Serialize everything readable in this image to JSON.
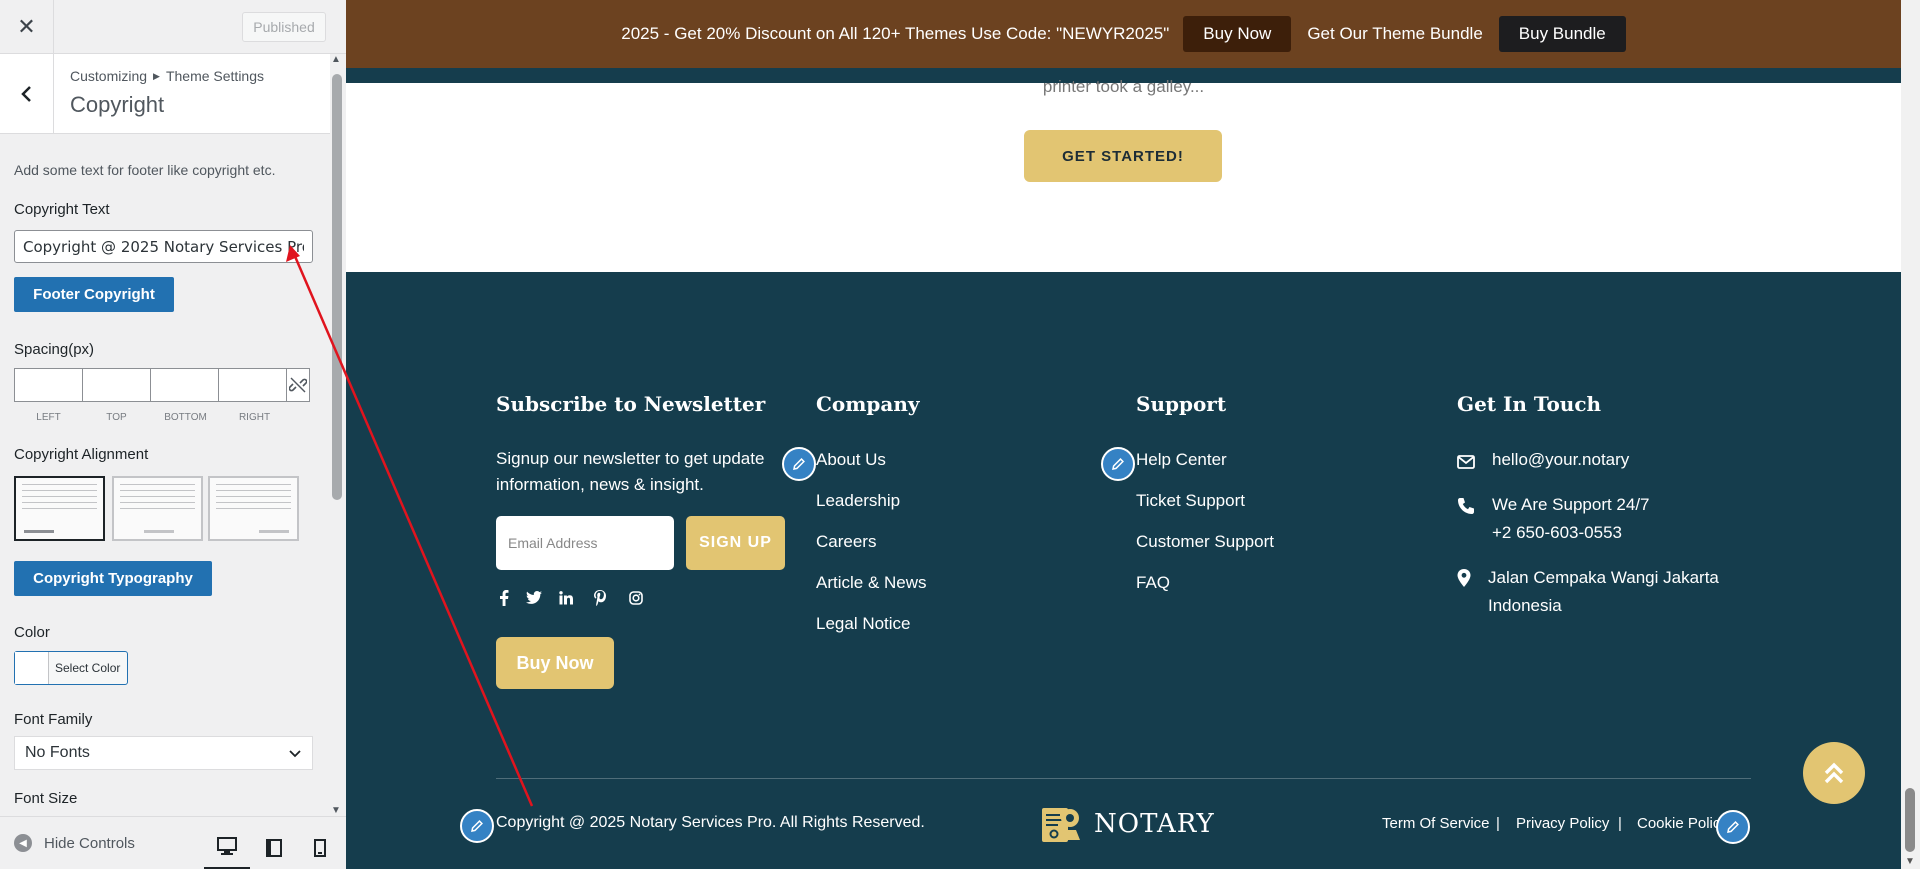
{
  "panel": {
    "close_label": "✕",
    "published_label": "Published",
    "breadcrumb_root": "Customizing",
    "breadcrumb_parent": "Theme Settings",
    "section_title": "Copyright",
    "description": "Add some text for footer like copyright etc.",
    "copyright_text_label": "Copyright Text",
    "copyright_text_value": "Copyright @ 2025 Notary Services Pro. All Rights Reserved.",
    "footer_copyright_button": "Footer Copyright",
    "spacing_label": "Spacing(px)",
    "spacing_captions": [
      "LEFT",
      "TOP",
      "BOTTOM",
      "RIGHT"
    ],
    "alignment_label": "Copyright Alignment",
    "typography_button": "Copyright Typography",
    "color_label": "Color",
    "select_color": "Select Color",
    "font_family_label": "Font Family",
    "font_family_value": "No Fonts",
    "font_size_label": "Font Size",
    "hide_controls": "Hide Controls"
  },
  "preview": {
    "promo": {
      "text": "2025 - Get 20% Discount on All 120+ Themes Use Code: \"NEWYR2025\"",
      "buy_now": "Buy Now",
      "bundle_text": "Get Our Theme Bundle",
      "buy_bundle": "Buy Bundle"
    },
    "hero_text": "printer took a galley...",
    "get_started": "GET STARTED!",
    "footer": {
      "newsletter_title": "Subscribe to Newsletter",
      "newsletter_desc": "Signup our newsletter to get update information, news & insight.",
      "email_placeholder": "Email Address",
      "signup": "SIGN UP",
      "buy_now": "Buy Now",
      "company_title": "Company",
      "company_links": [
        "About Us",
        "Leadership",
        "Careers",
        "Article & News",
        "Legal Notice"
      ],
      "support_title": "Support",
      "support_links": [
        "Help Center",
        "Ticket Support",
        "Customer Support",
        "FAQ"
      ],
      "contact_title": "Get In Touch",
      "email": "hello@your.notary",
      "phone_line1": "We Are Support 24/7",
      "phone_line2": "+2 650-603-0553",
      "address_line1": "Jalan Cempaka Wangi Jakarta",
      "address_line2": "Indonesia",
      "copyright": "Copyright @ 2025 Notary Services Pro. All Rights Reserved.",
      "logo_text": "NOTARY",
      "legal_links": [
        "Term Of Service",
        "Privacy Policy",
        "Cookie Policy"
      ],
      "legal_sep": "|"
    }
  },
  "colors": {
    "accent": "#2271b1",
    "gold": "#e2c572",
    "footer_bg": "#153d4d",
    "promo_bg": "#6c4220",
    "annotation": "#e0141e"
  }
}
